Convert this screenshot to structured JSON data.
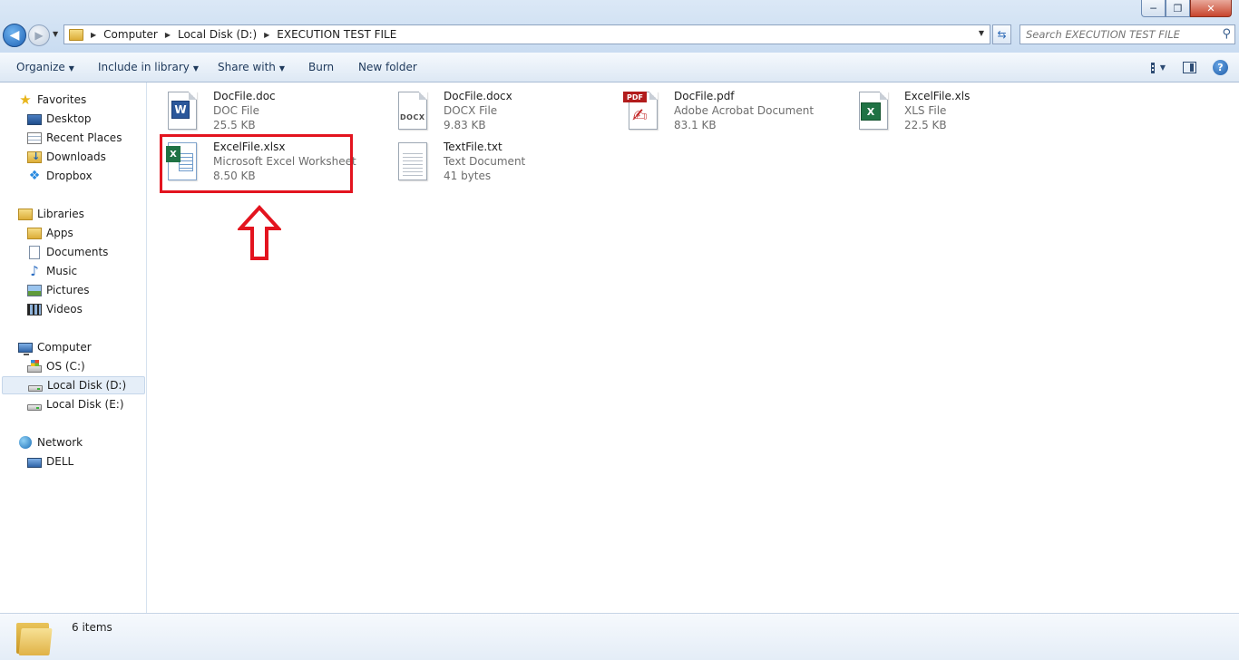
{
  "window": {
    "controls": {
      "minimize": "─",
      "maximize": "❐",
      "close": "✕"
    }
  },
  "address_bar": {
    "breadcrumbs": [
      "Computer",
      "Local Disk (D:)",
      "EXECUTION TEST FILE"
    ]
  },
  "search": {
    "placeholder": "Search EXECUTION TEST FILE"
  },
  "toolbar": {
    "organize": "Organize",
    "include_in_library": "Include in library",
    "share_with": "Share with",
    "burn": "Burn",
    "new_folder": "New folder"
  },
  "nav": {
    "favorites": {
      "label": "Favorites",
      "items": [
        "Desktop",
        "Recent Places",
        "Downloads",
        "Dropbox"
      ]
    },
    "libraries": {
      "label": "Libraries",
      "items": [
        "Apps",
        "Documents",
        "Music",
        "Pictures",
        "Videos"
      ]
    },
    "computer": {
      "label": "Computer",
      "items": [
        "OS (C:)",
        "Local Disk (D:)",
        "Local Disk (E:)"
      ],
      "selected": "Local Disk (D:)"
    },
    "network": {
      "label": "Network",
      "items": [
        "DELL"
      ]
    }
  },
  "files": [
    {
      "name": "DocFile.doc",
      "type": "DOC File",
      "size": "25.5 KB",
      "icon": "word-doc-icon"
    },
    {
      "name": "DocFile.docx",
      "type": "DOCX File",
      "size": "9.83 KB",
      "icon": "docx-icon",
      "icon_label": "DOCX"
    },
    {
      "name": "DocFile.pdf",
      "type": "Adobe Acrobat Document",
      "size": "83.1 KB",
      "icon": "pdf-icon",
      "icon_label": "PDF"
    },
    {
      "name": "ExcelFile.xls",
      "type": "XLS File",
      "size": "22.5 KB",
      "icon": "excel-xls-icon"
    },
    {
      "name": "ExcelFile.xlsx",
      "type": "Microsoft Excel Worksheet",
      "size": "8.50 KB",
      "icon": "excel-xlsx-icon"
    },
    {
      "name": "TextFile.txt",
      "type": "Text Document",
      "size": "41 bytes",
      "icon": "text-file-icon"
    }
  ],
  "annotation": {
    "highlight_color": "#e3141f"
  },
  "status": {
    "item_count": "6 items"
  }
}
